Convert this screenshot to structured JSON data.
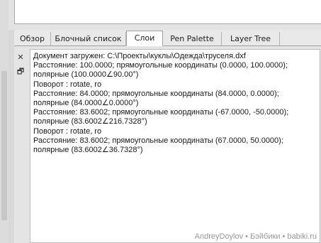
{
  "tabs": [
    {
      "label": "Обзор"
    },
    {
      "label": "Блочный список"
    },
    {
      "label": "Слои"
    },
    {
      "label": "Pen Palette"
    },
    {
      "label": "Layer Tree"
    }
  ],
  "active_tab": "Слои",
  "toolbar": {
    "close_icon": "close-icon",
    "restore_icon": "restore-window-icon"
  },
  "console": {
    "lines": [
      "Документ загружен: C:\\Проекты\\куклы\\Одежда\\труселя.dxf",
      "Расстояние: 100.0000; прямоугольные координаты (0.0000, 100.0000);",
      "полярные (100.0000∠90.00°)",
      "Поворот : rotate, ro",
      "Расстояние: 84.0000; прямоугольные координаты (84.0000, 0.0000);",
      "полярные (84.0000∠0.0000°)",
      "Расстояние: 83.6002; прямоугольные координаты (-67.0000, -50.0000);",
      "полярные (83.6002∠216.7328°)",
      "Поворот : rotate, ro",
      "Расстояние: 83.6002; прямоугольные координаты (67.0000, 50.0000);",
      "полярные (83.6002∠36.7328°)"
    ]
  },
  "watermark": "AndreyDoylov • Бэйбики • babiki.ru"
}
